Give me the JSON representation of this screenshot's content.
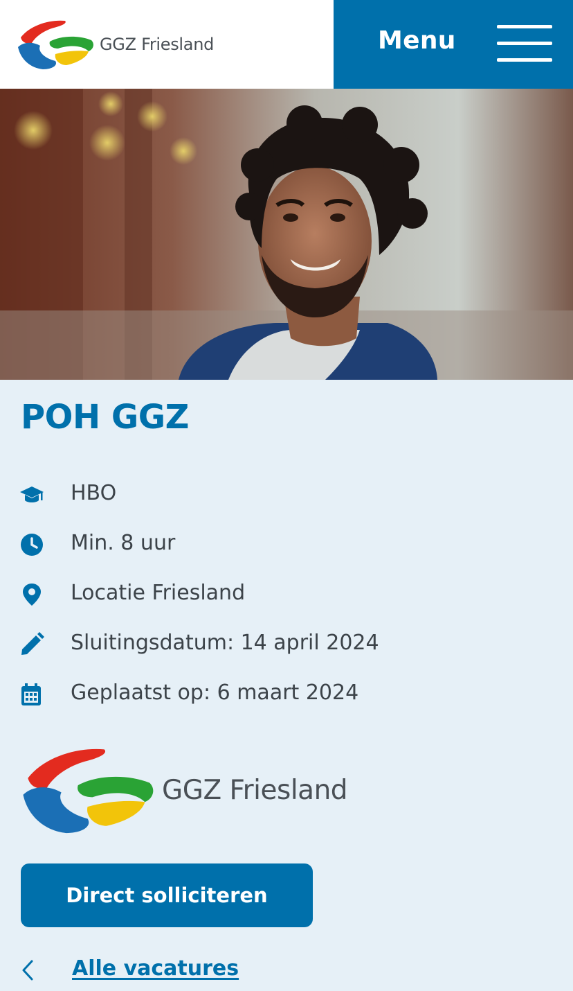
{
  "header": {
    "logo_text": "GGZ Friesland",
    "menu_label": "Menu"
  },
  "colors": {
    "brand_blue": "#0070ab",
    "background": "#e6f0f7",
    "logo_red": "#e32b1f",
    "logo_green": "#2aa335",
    "logo_blue": "#1b6fb5",
    "logo_yellow": "#f2c40a"
  },
  "hero": {
    "description": "photo-hero"
  },
  "vacancy": {
    "title": "POH GGZ",
    "facts": [
      {
        "icon": "graduation-cap-icon",
        "text": "HBO"
      },
      {
        "icon": "clock-icon",
        "text": "Min. 8 uur"
      },
      {
        "icon": "location-pin-icon",
        "text": "Locatie Friesland"
      },
      {
        "icon": "pencil-icon",
        "text": "Sluitingsdatum: 14 april 2024"
      },
      {
        "icon": "calendar-icon",
        "text": "Geplaatst op: 6 maart 2024"
      }
    ]
  },
  "employer": {
    "logo_text": "GGZ Friesland"
  },
  "actions": {
    "apply_label": "Direct solliciteren",
    "back_label": "Alle vacatures"
  }
}
